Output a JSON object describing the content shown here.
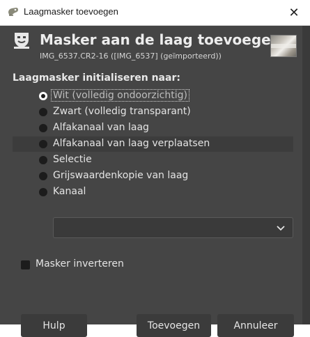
{
  "window": {
    "title": "Laagmasker toevoegen",
    "close_glyph": "✕"
  },
  "header": {
    "title": "Masker aan de laag toevoegen",
    "subtitle": "IMG_6537.CR2-16 ([IMG_6537] (geïmporteerd))",
    "icon": "layer-mask-icon",
    "thumbnail": "layer-thumbnail"
  },
  "init": {
    "label": "Laagmasker initialiseren naar:",
    "options": [
      {
        "label": "Wit (volledig ondoorzichtig)",
        "checked": true
      },
      {
        "label": "Zwart (volledig transparant)",
        "checked": false
      },
      {
        "label": "Alfakanaal van laag",
        "checked": false
      },
      {
        "label": "Alfakanaal van laag verplaatsen",
        "checked": false,
        "highlighted": true
      },
      {
        "label": "Selectie",
        "checked": false
      },
      {
        "label": "Grijswaardenkopie van laag",
        "checked": false
      },
      {
        "label": "Kanaal",
        "checked": false
      }
    ],
    "channel_value": ""
  },
  "invert": {
    "label": "Masker inverteren",
    "checked": false
  },
  "buttons": {
    "help": "Hulp",
    "add": "Toevoegen",
    "cancel": "Annuleer"
  },
  "colors": {
    "dialog_bg": "#454545",
    "highlight": "#3c3c3c",
    "text": "#e4e4e4"
  }
}
